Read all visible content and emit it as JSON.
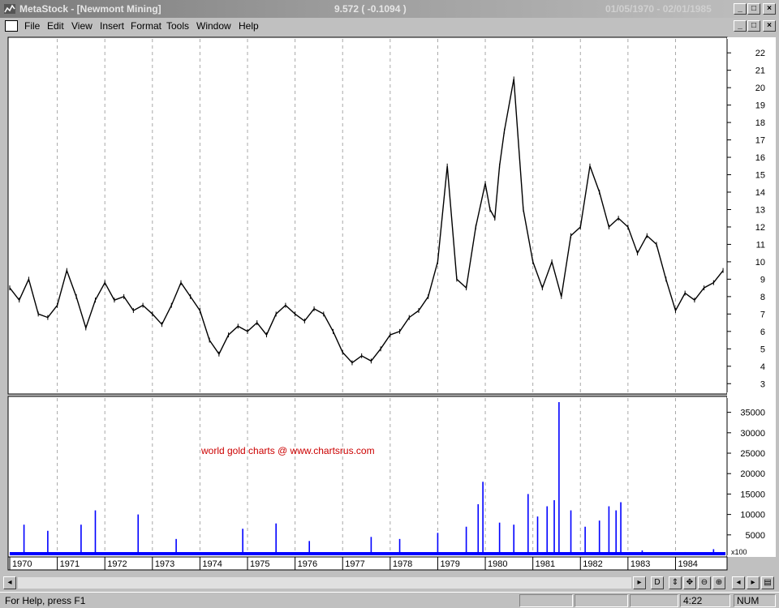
{
  "window": {
    "title": "MetaStock - [Newmont Mining]",
    "price_readout": "9.572 ( -0.1094 )",
    "date_range": "01/05/1970 - 02/01/1985",
    "minimize": "_",
    "maximize": "□",
    "close": "×"
  },
  "menu": {
    "items": [
      "File",
      "Edit",
      "View",
      "Insert",
      "Format",
      "Tools",
      "Window",
      "Help"
    ]
  },
  "chart_data": [
    {
      "type": "line",
      "title": "",
      "xlabel": "",
      "ylabel": "",
      "x": [
        1970.0,
        1970.2,
        1970.4,
        1970.6,
        1970.8,
        1971.0,
        1971.2,
        1971.4,
        1971.6,
        1971.8,
        1972.0,
        1972.2,
        1972.4,
        1972.6,
        1972.8,
        1973.0,
        1973.2,
        1973.4,
        1973.6,
        1973.8,
        1974.0,
        1974.2,
        1974.4,
        1974.6,
        1974.8,
        1975.0,
        1975.2,
        1975.4,
        1975.6,
        1975.8,
        1976.0,
        1976.2,
        1976.4,
        1976.6,
        1976.8,
        1977.0,
        1977.2,
        1977.4,
        1977.6,
        1977.8,
        1978.0,
        1978.2,
        1978.4,
        1978.6,
        1978.8,
        1979.0,
        1979.2,
        1979.4,
        1979.6,
        1979.8,
        1980.0,
        1980.1,
        1980.2,
        1980.3,
        1980.4,
        1980.6,
        1980.8,
        1981.0,
        1981.2,
        1981.4,
        1981.6,
        1981.8,
        1982.0,
        1982.2,
        1982.4,
        1982.6,
        1982.8,
        1983.0,
        1983.2,
        1983.4,
        1983.6,
        1983.8,
        1984.0,
        1984.2,
        1984.4,
        1984.6,
        1984.8,
        1985.0
      ],
      "series": [
        {
          "values": [
            8.5,
            7.8,
            9.0,
            7.0,
            6.8,
            7.5,
            9.5,
            8.0,
            6.2,
            7.8,
            8.8,
            7.8,
            8.0,
            7.2,
            7.5,
            7.0,
            6.4,
            7.5,
            8.8,
            8.0,
            7.2,
            5.5,
            4.7,
            5.8,
            6.3,
            6.0,
            6.5,
            5.8,
            7.0,
            7.5,
            7.0,
            6.6,
            7.3,
            7.0,
            6.0,
            4.8,
            4.2,
            4.6,
            4.3,
            5.0,
            5.8,
            6.0,
            6.8,
            7.2,
            8.0,
            10.0,
            15.5,
            9.0,
            8.5,
            12.0,
            14.5,
            13.0,
            12.5,
            15.5,
            17.5,
            20.5,
            13.0,
            10.0,
            8.5,
            10.0,
            8.0,
            11.5,
            12.0,
            15.5,
            14.0,
            12.0,
            12.5,
            12.0,
            10.5,
            11.5,
            11.0,
            9.0,
            7.2,
            8.2,
            7.8,
            8.5,
            8.8,
            9.5
          ]
        }
      ],
      "ylim": [
        2.5,
        22.8
      ],
      "yticks": [
        "22",
        "21",
        "20",
        "19",
        "18",
        "17",
        "16",
        "15",
        "14",
        "13",
        "12",
        "11",
        "10",
        "9",
        "8",
        "7",
        "6",
        "5",
        "4",
        "3"
      ],
      "grid": true
    },
    {
      "type": "bar",
      "title": "",
      "xlabel": "",
      "ylabel": "",
      "annotation": "world gold charts @ www.chartsrus.com",
      "unit_label": "x100",
      "categories": [
        "1970",
        "1971",
        "1972",
        "1973",
        "1974",
        "1975",
        "1976",
        "1977",
        "1978",
        "1979",
        "1980",
        "1981",
        "1982",
        "1983",
        "1984"
      ],
      "x": [
        1970.3,
        1970.8,
        1971.5,
        1971.8,
        1972.7,
        1973.5,
        1974.9,
        1975.6,
        1976.3,
        1977.6,
        1978.2,
        1979.0,
        1979.6,
        1979.85,
        1979.95,
        1980.3,
        1980.6,
        1980.9,
        1981.1,
        1981.3,
        1981.45,
        1981.55,
        1981.8,
        1982.1,
        1982.4,
        1982.6,
        1982.75,
        1982.85,
        1983.3,
        1984.2,
        1984.8
      ],
      "series": [
        {
          "values": [
            7500,
            6000,
            7500,
            11000,
            10000,
            4000,
            6500,
            7800,
            3500,
            4500,
            4000,
            5500,
            7000,
            12500,
            18000,
            8000,
            7500,
            15000,
            9500,
            12000,
            13500,
            37500,
            11000,
            7000,
            8500,
            12000,
            11000,
            13000,
            1200,
            800,
            1500
          ]
        }
      ],
      "ylim": [
        0,
        38500
      ],
      "yticks": [
        "35000",
        "30000",
        "25000",
        "20000",
        "15000",
        "10000",
        "5000"
      ],
      "grid": true
    }
  ],
  "xaxis": {
    "years": [
      "1970",
      "1971",
      "1972",
      "1973",
      "1974",
      "1975",
      "1976",
      "1977",
      "1978",
      "1979",
      "1980",
      "1981",
      "1982",
      "1983",
      "1984"
    ]
  },
  "toolbar": {
    "buttons": [
      "D",
      "⇕",
      "✥",
      "⊖",
      "⊕",
      "◂",
      "▸",
      "▤"
    ]
  },
  "status": {
    "help": "For Help, press F1",
    "time": "4:22",
    "num": "NUM"
  },
  "colors": {
    "price": "#000000",
    "volume": "#0000ff",
    "annotation": "#cc0000",
    "grid": "#a8a8a8"
  }
}
